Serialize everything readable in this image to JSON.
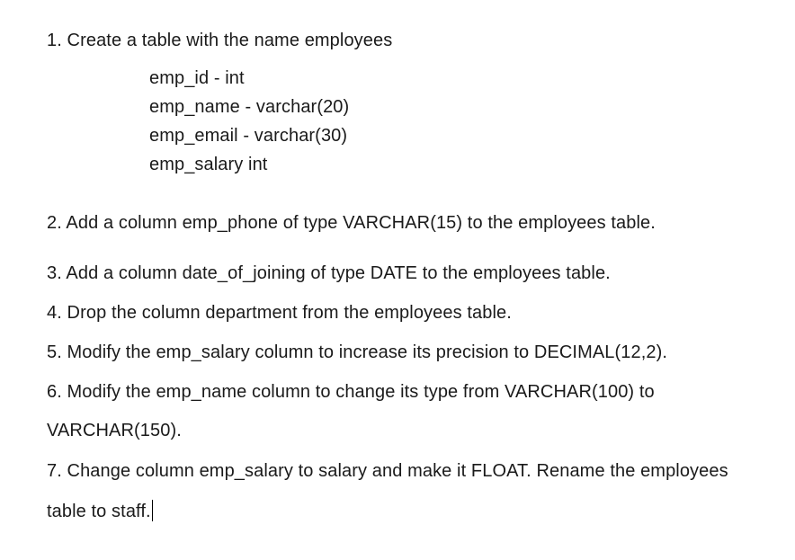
{
  "items": [
    {
      "text": "1. Create a table with the name employees",
      "columns": [
        "emp_id - int",
        "emp_name - varchar(20)",
        "emp_email - varchar(30)",
        "emp_salary int"
      ]
    },
    {
      "text": "2. Add a column emp_phone of type VARCHAR(15) to the employees table."
    },
    {
      "text": "3. Add a column date_of_joining of type DATE to the employees table."
    },
    {
      "text": "4. Drop the column department from the employees table."
    },
    {
      "text": "5. Modify the emp_salary column to increase its precision to DECIMAL(12,2)."
    },
    {
      "text": "6. Modify the emp_name column to change its type from VARCHAR(100) to",
      "continuation": "VARCHAR(150)."
    },
    {
      "text": "7. Change column emp_salary to salary and make it FLOAT. Rename the employees",
      "continuation": "table to staff."
    }
  ]
}
